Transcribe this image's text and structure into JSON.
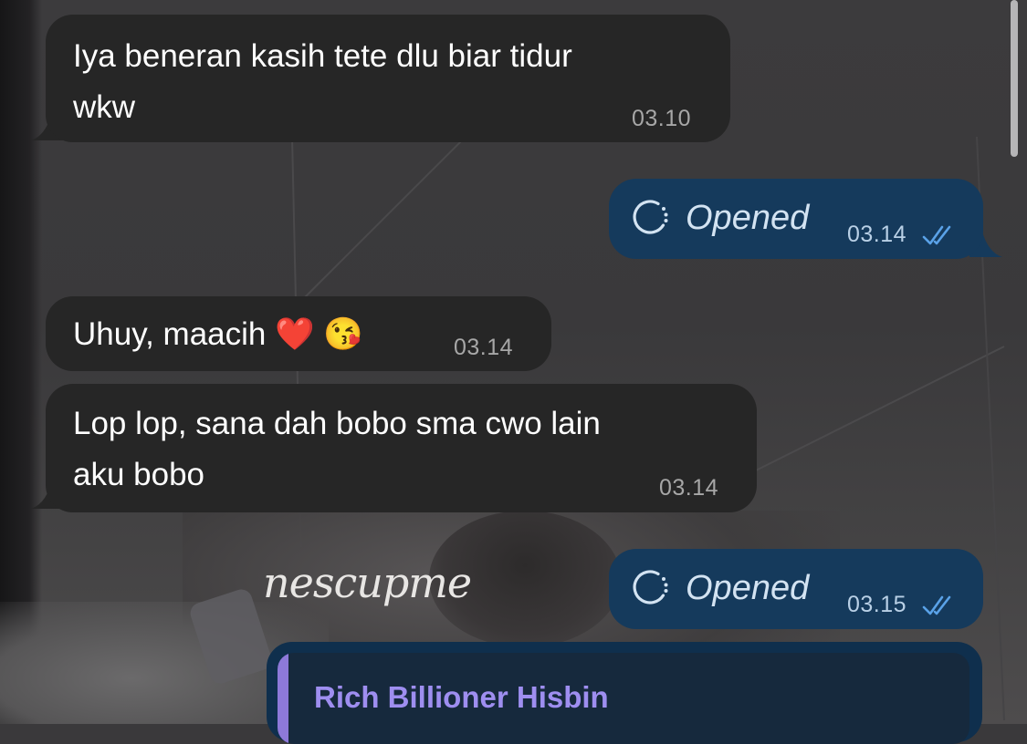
{
  "messages": [
    {
      "type": "incoming",
      "text": "Iya beneran kasih tete dlu biar tidur\nwkw",
      "time": "03.10"
    },
    {
      "type": "outgoing",
      "text": "Opened",
      "time": "03.14",
      "status": "read",
      "icon": "view-once-icon"
    },
    {
      "type": "incoming",
      "text": "Uhuy, maacih ❤️ 😘",
      "time": "03.14"
    },
    {
      "type": "incoming",
      "text": "Lop lop, sana dah bobo sma cwo lain\naku bobo",
      "time": "03.14"
    },
    {
      "type": "outgoing",
      "text": "Opened",
      "time": "03.15",
      "status": "read",
      "icon": "view-once-icon"
    }
  ],
  "watermark": "nescupme",
  "reply": {
    "sender": "Rich Billioner Hisbin",
    "accent_color": "#8d79d9"
  },
  "colors": {
    "incoming_bubble": "#262626",
    "outgoing_bubble": "#153a5c",
    "read_ticks": "#5aa2e8"
  }
}
